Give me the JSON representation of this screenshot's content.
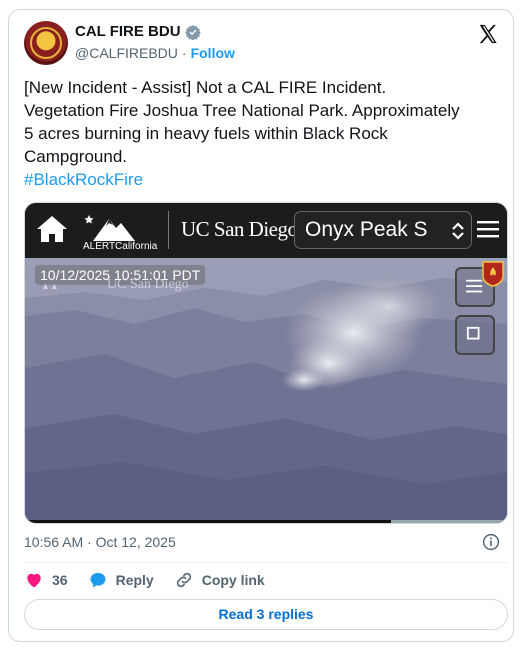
{
  "author": {
    "display_name": "CAL FIRE BDU",
    "handle": "@CALFIREBDU",
    "separator": "·",
    "follow_label": "Follow"
  },
  "tweet": {
    "lines": [
      "[New Incident - Assist] Not a CAL FIRE Incident.",
      "Vegetation Fire Joshua Tree National Park. Approximately",
      "5 acres burning in heavy fuels within Black Rock",
      "Campground."
    ],
    "hashtag": "#BlackRockFire"
  },
  "media": {
    "brand": "ALERTCalifornia",
    "partner": "UC San Diego",
    "camera_select": "Onyx Peak S",
    "timestamp": "10/12/2025 10:51:01 PDT",
    "watermark_partner": "UC San Diego",
    "progress_fraction": 0.76
  },
  "meta": {
    "time": "10:56 AM · Oct 12, 2025"
  },
  "actions": {
    "like_count": "36",
    "reply_label": "Reply",
    "copy_link_label": "Copy link"
  },
  "replies_button": "Read 3 replies",
  "colors": {
    "accent": "#1d9bf0",
    "like": "#f91880",
    "link": "#006fd6",
    "muted": "#536471"
  }
}
